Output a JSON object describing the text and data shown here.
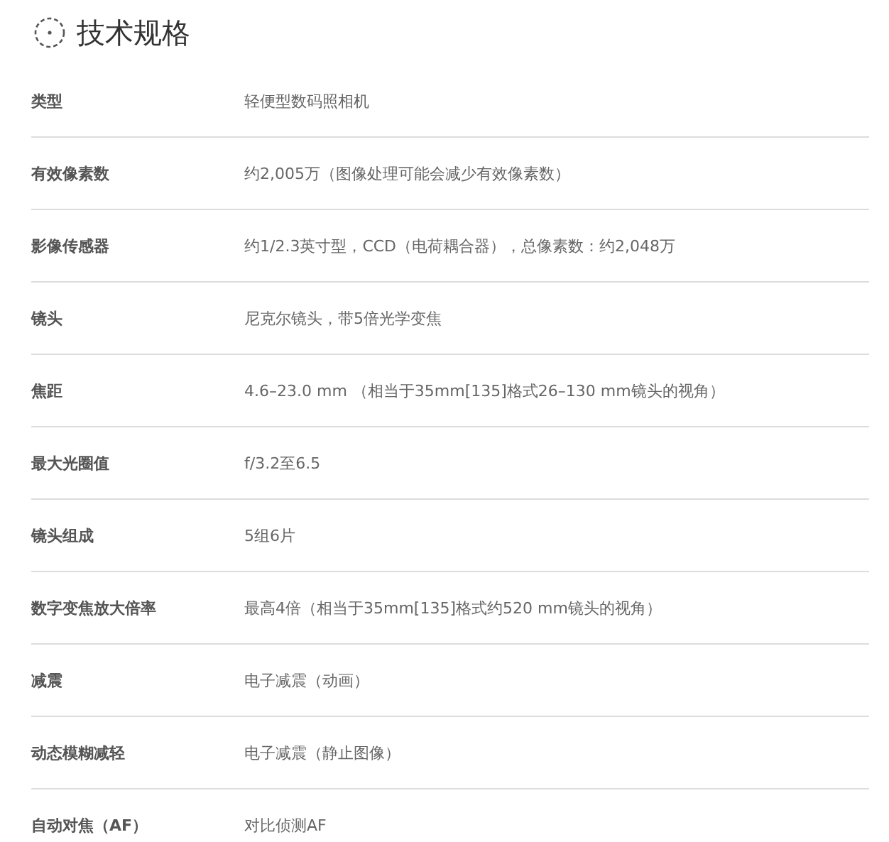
{
  "title": "技术规格",
  "specs": [
    {
      "label": "类型",
      "value": "轻便型数码照相机"
    },
    {
      "label": "有效像素数",
      "value": "约2,005万（图像处理可能会减少有效像素数）"
    },
    {
      "label": "影像传感器",
      "value": "约1/2.3英寸型，CCD（电荷耦合器），总像素数：约2,048万"
    },
    {
      "label": "镜头",
      "value": "尼克尔镜头，带5倍光学变焦"
    },
    {
      "label": "焦距",
      "value": "4.6–23.0 mm （相当于35mm[135]格式26–130 mm镜头的视角）"
    },
    {
      "label": "最大光圈值",
      "value": "f/3.2至6.5"
    },
    {
      "label": "镜头组成",
      "value": "5组6片"
    },
    {
      "label": "数字变焦放大倍率",
      "value": "最高4倍（相当于35mm[135]格式约520 mm镜头的视角）"
    },
    {
      "label": "减震",
      "value": "电子减震（动画）"
    },
    {
      "label": "动态模糊减轻",
      "value": "电子减震（静止图像）"
    },
    {
      "label": "自动对焦（AF）",
      "value": "对比侦测AF"
    }
  ]
}
